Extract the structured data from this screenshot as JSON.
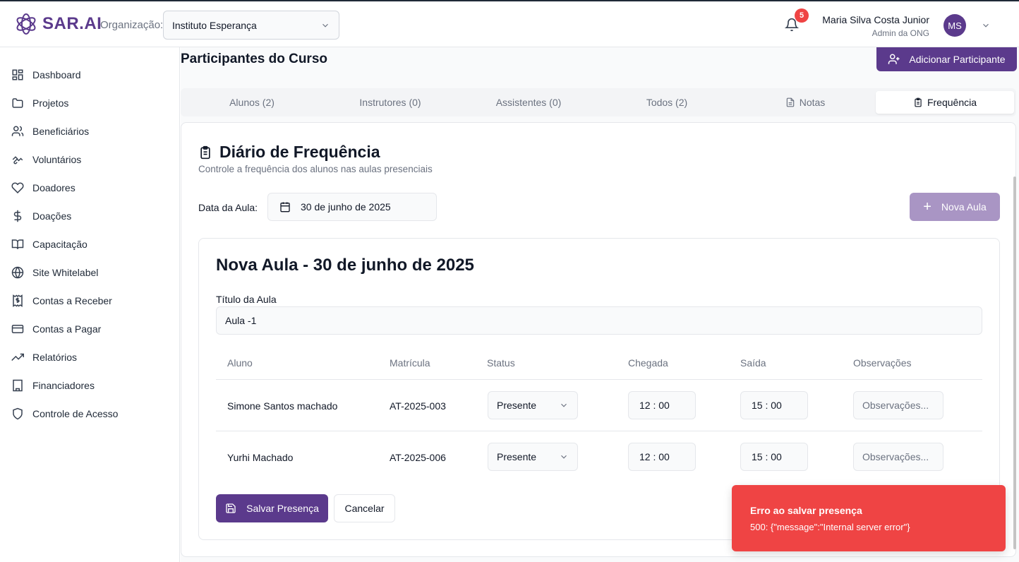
{
  "header": {
    "logo_text": "SAR.AI",
    "org_label": "Organização:",
    "org_value": "Instituto Esperança",
    "notification_count": "5",
    "user_name": "Maria Silva Costa Junior",
    "user_role": "Admin da ONG",
    "avatar_initials": "MS"
  },
  "sidebar": {
    "items": [
      {
        "label": "Dashboard",
        "icon": "dashboard-icon"
      },
      {
        "label": "Projetos",
        "icon": "folder-icon"
      },
      {
        "label": "Beneficiários",
        "icon": "users-icon"
      },
      {
        "label": "Voluntários",
        "icon": "handshake-icon"
      },
      {
        "label": "Doadores",
        "icon": "heart-icon"
      },
      {
        "label": "Doações",
        "icon": "dollar-icon"
      },
      {
        "label": "Capacitação",
        "icon": "book-icon"
      },
      {
        "label": "Site Whitelabel",
        "icon": "globe-icon"
      },
      {
        "label": "Contas a Receber",
        "icon": "receipt-icon"
      },
      {
        "label": "Contas a Pagar",
        "icon": "credit-card-icon"
      },
      {
        "label": "Relatórios",
        "icon": "trending-up-icon"
      },
      {
        "label": "Financiadores",
        "icon": "building-icon"
      },
      {
        "label": "Controle de Acesso",
        "icon": "shield-icon"
      }
    ]
  },
  "main": {
    "page_title": "Participantes do Curso",
    "add_button": "Adicionar Participante",
    "tabs": [
      {
        "label": "Alunos (2)"
      },
      {
        "label": "Instrutores (0)"
      },
      {
        "label": "Assistentes (0)"
      },
      {
        "label": "Todos (2)"
      },
      {
        "label": "Notas"
      },
      {
        "label": "Frequência",
        "active": true
      }
    ]
  },
  "card": {
    "title": "Diário de Frequência",
    "subtitle": "Controle a frequência dos alunos nas aulas presenciais",
    "date_label": "Data da Aula:",
    "date_value": "30 de junho de 2025",
    "new_class_button": "Nova Aula"
  },
  "form": {
    "title": "Nova Aula - 30 de junho de 2025",
    "class_title_label": "Título da Aula",
    "class_title_value": "Aula -1",
    "columns": [
      "Aluno",
      "Matrícula",
      "Status",
      "Chegada",
      "Saída",
      "Observações"
    ],
    "rows": [
      {
        "student": "Simone Santos machado",
        "enrollment": "AT-2025-003",
        "status": "Presente",
        "arrival": "12 : 00",
        "departure": "15 : 00",
        "notes_placeholder": "Observações..."
      },
      {
        "student": "Yurhi Machado",
        "enrollment": "AT-2025-006",
        "status": "Presente",
        "arrival": "12 : 00",
        "departure": "15 : 00",
        "notes_placeholder": "Observações..."
      }
    ],
    "save_button": "Salvar Presença",
    "cancel_button": "Cancelar"
  },
  "toast": {
    "title": "Erro ao salvar presença",
    "message": "500: {\"message\":\"Internal server error\"}"
  },
  "colors": {
    "brand": "#5b3a8c",
    "brand_disabled": "#a995c4",
    "error": "#ef4444"
  }
}
